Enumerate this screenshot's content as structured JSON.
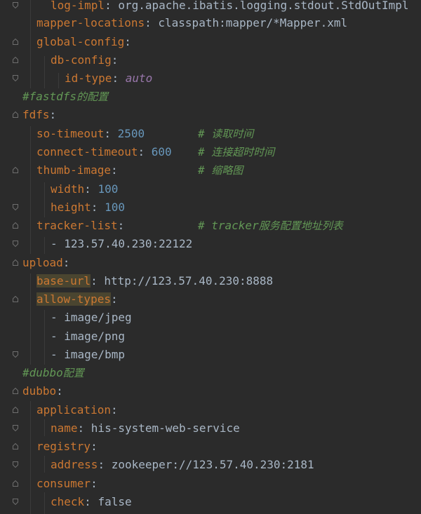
{
  "lines": [
    {
      "key": "log-impl",
      "value": "org.apache.ibatis.logging.stdout.StdOutImpl"
    },
    {
      "key": "mapper-locations",
      "value": "classpath:mapper/*Mapper.xml"
    },
    {
      "key": "global-config",
      "value": ""
    },
    {
      "key": "db-config",
      "value": ""
    },
    {
      "key": "id-type",
      "value": "auto"
    },
    {
      "comment": "#fastdfs",
      "comment_cjk": "的配置"
    },
    {
      "key": "fdfs",
      "value": ""
    },
    {
      "key": "so-timeout",
      "value": "2500",
      "comment": "# ",
      "comment_cjk": "读取时间"
    },
    {
      "key": "connect-timeout",
      "value": "600",
      "comment": "# ",
      "comment_cjk": "连接超时时间"
    },
    {
      "key": "thumb-image",
      "value": "",
      "comment": "# ",
      "comment_cjk": "缩略图"
    },
    {
      "key": "width",
      "value": "100"
    },
    {
      "key": "height",
      "value": "100"
    },
    {
      "key": "tracker-list",
      "value": "",
      "comment": "# tracker",
      "comment_cjk": "服务配置地址列表"
    },
    {
      "value": "- 123.57.40.230:22122"
    },
    {
      "key": "upload",
      "value": ""
    },
    {
      "key": "base-url",
      "value": "http://123.57.40.230:8888"
    },
    {
      "key": "allow-types",
      "value": ""
    },
    {
      "value": "- image/jpeg"
    },
    {
      "value": "- image/png"
    },
    {
      "value": "- image/bmp"
    },
    {
      "comment": "#dubbo",
      "comment_cjk": "配置"
    },
    {
      "key": "dubbo",
      "value": ""
    },
    {
      "key": "application",
      "value": ""
    },
    {
      "key": "name",
      "value": "his-system-web-service"
    },
    {
      "key": "registry",
      "value": ""
    },
    {
      "key": "address",
      "value": "zookeeper://123.57.40.230:2181"
    },
    {
      "key": "consumer",
      "value": ""
    },
    {
      "key": "check",
      "value": "false"
    }
  ],
  "colors": {
    "background": "#2b2b2b",
    "key": "#cc7832",
    "text": "#a9b7c6",
    "number": "#6897bb",
    "keyword_value": "#9876aa",
    "comment": "#629755",
    "highlight": "#4a4530"
  },
  "icons": [
    "fold-open-icon",
    "fold-close-icon"
  ]
}
